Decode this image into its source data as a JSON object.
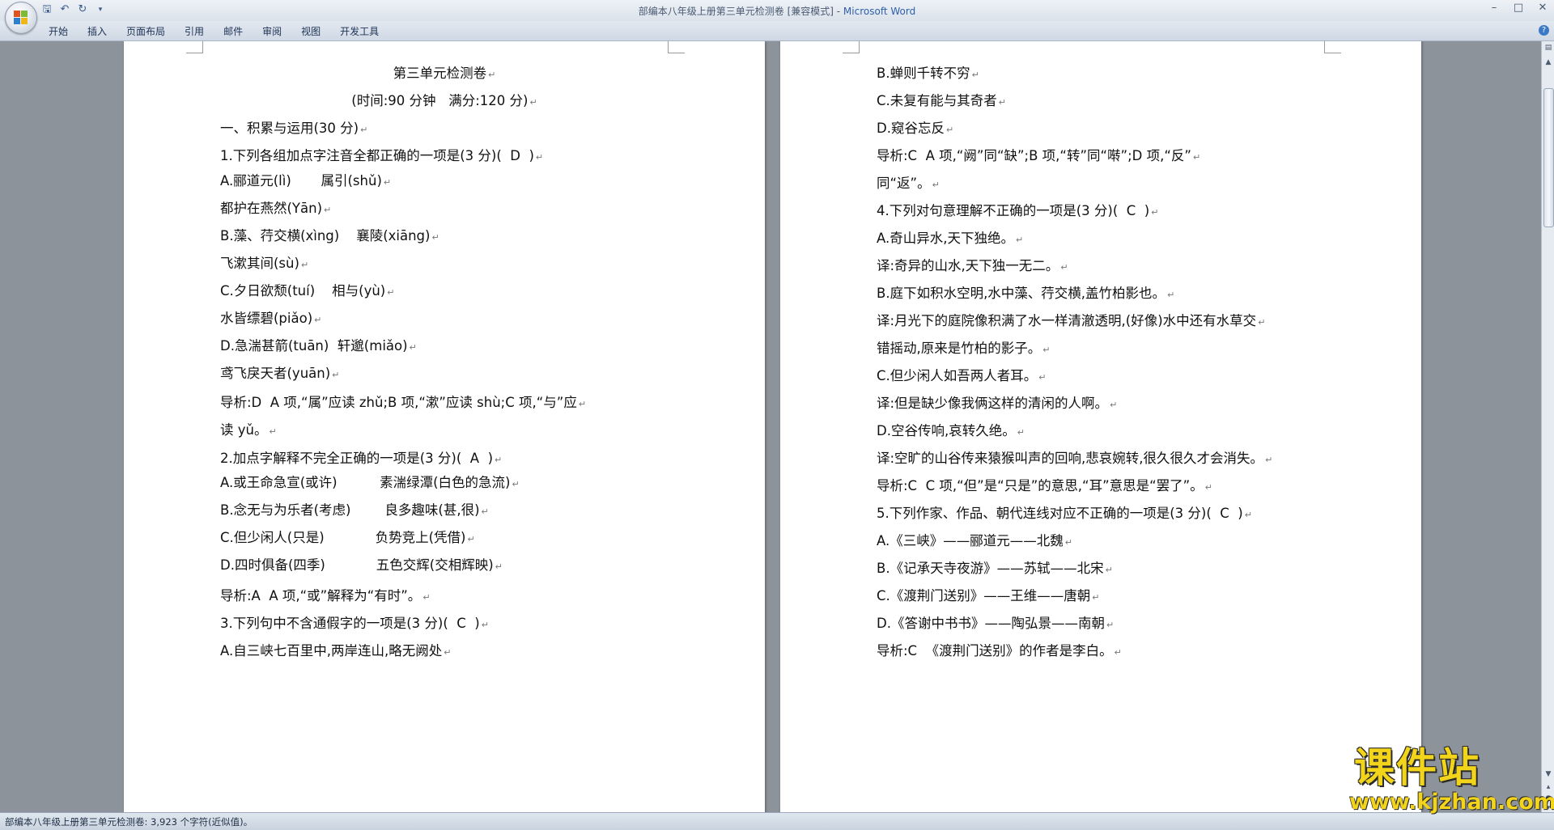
{
  "window": {
    "title_doc": "部编本八年级上册第三单元检测卷 [兼容模式] - ",
    "title_app": "Microsoft Word"
  },
  "ribbon": {
    "tabs": [
      "开始",
      "插入",
      "页面布局",
      "引用",
      "邮件",
      "审阅",
      "视图",
      "开发工具"
    ]
  },
  "page1": {
    "lines": [
      "第三单元检测卷",
      "(时间:90 分钟   满分:120 分)",
      "一、积累与运用(30 分)",
      "1.下列各组加点字注音全都正确的一项是(3 分)(  D  )",
      "A.郦道元(lì)       属引(shǔ)",
      "都护在燕然(Yān)",
      "B.藻、荇交横(xìng)    襄陵(xiāng)",
      "飞漱其间(sù)",
      "C.夕日欲颓(tuí)    相与(yù)",
      "水皆缥碧(piǎo)",
      "D.急湍甚箭(tuān)  轩邈(miǎo)",
      "鸢飞戾天者(yuān)",
      "导析:D  A 项,“属”应读 zhǔ;B 项,“漱”应读 shù;C 项,“与”应",
      "读 yǔ。",
      "2.加点字解释不完全正确的一项是(3 分)(  A  )",
      "A.或王命急宣(或许)          素湍绿潭(白色的急流)",
      "B.念无与为乐者(考虑)        良多趣味(甚,很)",
      "C.但少闲人(只是)            负势竞上(凭借)",
      "D.四时俱备(四季)            五色交辉(交相辉映)",
      "导析:A  A 项,“或”解释为“有时”。",
      "3.下列句中不含通假字的一项是(3 分)(  C  )",
      "A.自三峡七百里中,两岸连山,略无阙处"
    ]
  },
  "page2": {
    "lines": [
      "B.蝉则千转不穷",
      "C.未复有能与其奇者",
      "D.窥谷忘反",
      "导析:C  A 项,“阙”同“缺”;B 项,“转”同“啭”;D 项,“反”",
      "同“返”。",
      "4.下列对句意理解不正确的一项是(3 分)(  C  )",
      "A.奇山异水,天下独绝。",
      "译:奇异的山水,天下独一无二。",
      "B.庭下如积水空明,水中藻、荇交横,盖竹柏影也。",
      "译:月光下的庭院像积满了水一样清澈透明,(好像)水中还有水草交",
      "错摇动,原来是竹柏的影子。",
      "C.但少闲人如吾两人者耳。",
      "译:但是缺少像我俩这样的清闲的人啊。",
      "D.空谷传响,哀转久绝。",
      "译:空旷的山谷传来猿猴叫声的回响,悲哀婉转,很久很久才会消失。",
      "导析:C  C 项,“但”是“只是”的意思,“耳”意思是“罢了”。",
      "5.下列作家、作品、朝代连线对应不正确的一项是(3 分)(  C  )",
      "A.《三峡》——郦道元——北魏",
      "B.《记承天寺夜游》——苏轼——北宋",
      "C.《渡荆门送别》——王维——唐朝",
      "D.《答谢中书书》——陶弘景——南朝",
      "导析:C  《渡荆门送别》的作者是李白。"
    ]
  },
  "statusbar": {
    "text": "部编本八年级上册第三单元检测卷: 3,923 个字符(近似值)。"
  },
  "watermark": {
    "main": "课件站",
    "sub": "www.kjzhan.com"
  }
}
